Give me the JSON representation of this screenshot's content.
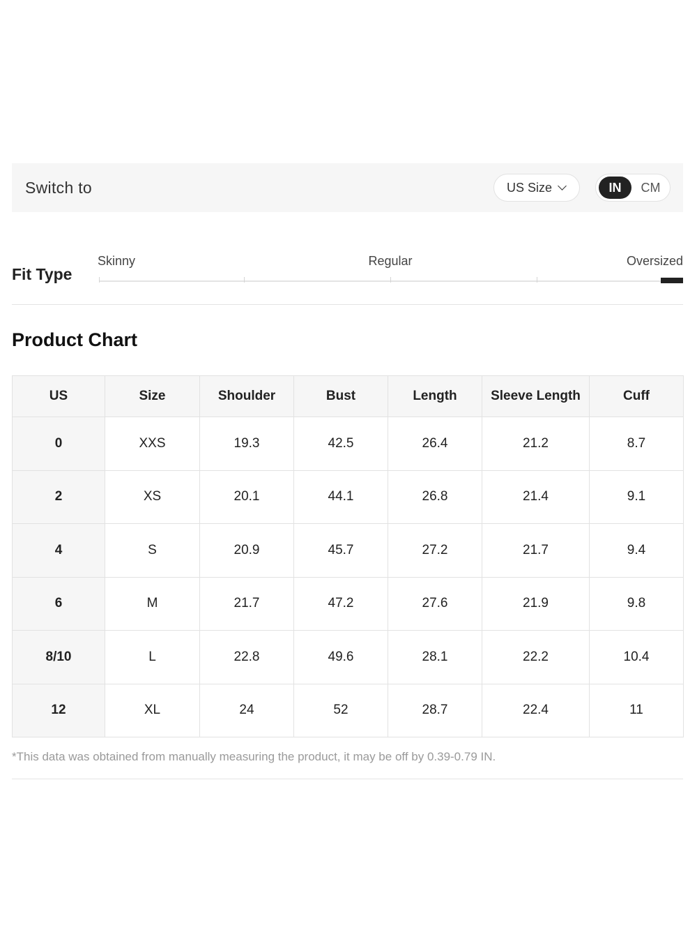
{
  "switch": {
    "label": "Switch to",
    "size_system": "US Size",
    "units": {
      "active": "IN",
      "inactive": "CM"
    }
  },
  "fit": {
    "label": "Fit Type",
    "scale": [
      "Skinny",
      "Regular",
      "Oversized"
    ],
    "selected": "Oversized"
  },
  "chart": {
    "title": "Product Chart",
    "headers": [
      "US",
      "Size",
      "Shoulder",
      "Bust",
      "Length",
      "Sleeve Length",
      "Cuff"
    ],
    "rows": [
      [
        "0",
        "XXS",
        "19.3",
        "42.5",
        "26.4",
        "21.2",
        "8.7"
      ],
      [
        "2",
        "XS",
        "20.1",
        "44.1",
        "26.8",
        "21.4",
        "9.1"
      ],
      [
        "4",
        "S",
        "20.9",
        "45.7",
        "27.2",
        "21.7",
        "9.4"
      ],
      [
        "6",
        "M",
        "21.7",
        "47.2",
        "27.6",
        "21.9",
        "9.8"
      ],
      [
        "8/10",
        "L",
        "22.8",
        "49.6",
        "28.1",
        "22.2",
        "10.4"
      ],
      [
        "12",
        "XL",
        "24",
        "52",
        "28.7",
        "22.4",
        "11"
      ]
    ],
    "note": "*This data was obtained from manually measuring the product, it may be off by 0.39-0.79 IN."
  },
  "colors": {
    "accent": "#222222",
    "panel": "#f6f6f6",
    "border": "#e2e2e2",
    "note": "#9a9a9a"
  }
}
